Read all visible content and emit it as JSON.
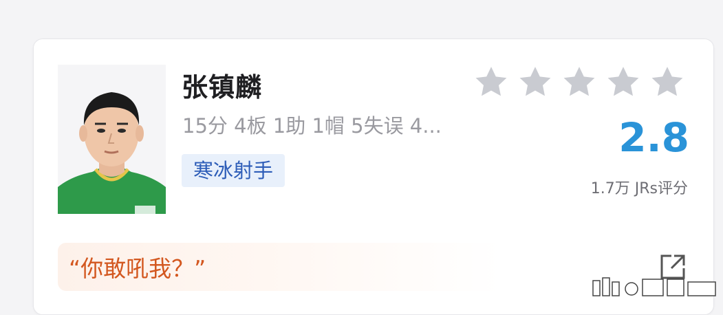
{
  "player": {
    "name": "张镇麟",
    "stats_line": "15分 4板 1助 1帽 5失误 4...",
    "tag": "寒冰射手"
  },
  "rating": {
    "stars_filled": 0,
    "stars_total": 5,
    "score": "2.8",
    "votes_label": "1.7万 JRs评分"
  },
  "comment": {
    "quote": "“你敢吼我？”"
  },
  "colors": {
    "accent_blue": "#2a93d8",
    "tag_text": "#2d5db8",
    "tag_bg": "#e8f0fb",
    "quote_orange": "#d3571f",
    "star_gray": "#c9cbd1",
    "jersey_green": "#2e9a4a"
  },
  "icons": {
    "share": "share-icon",
    "star": "star-icon"
  }
}
